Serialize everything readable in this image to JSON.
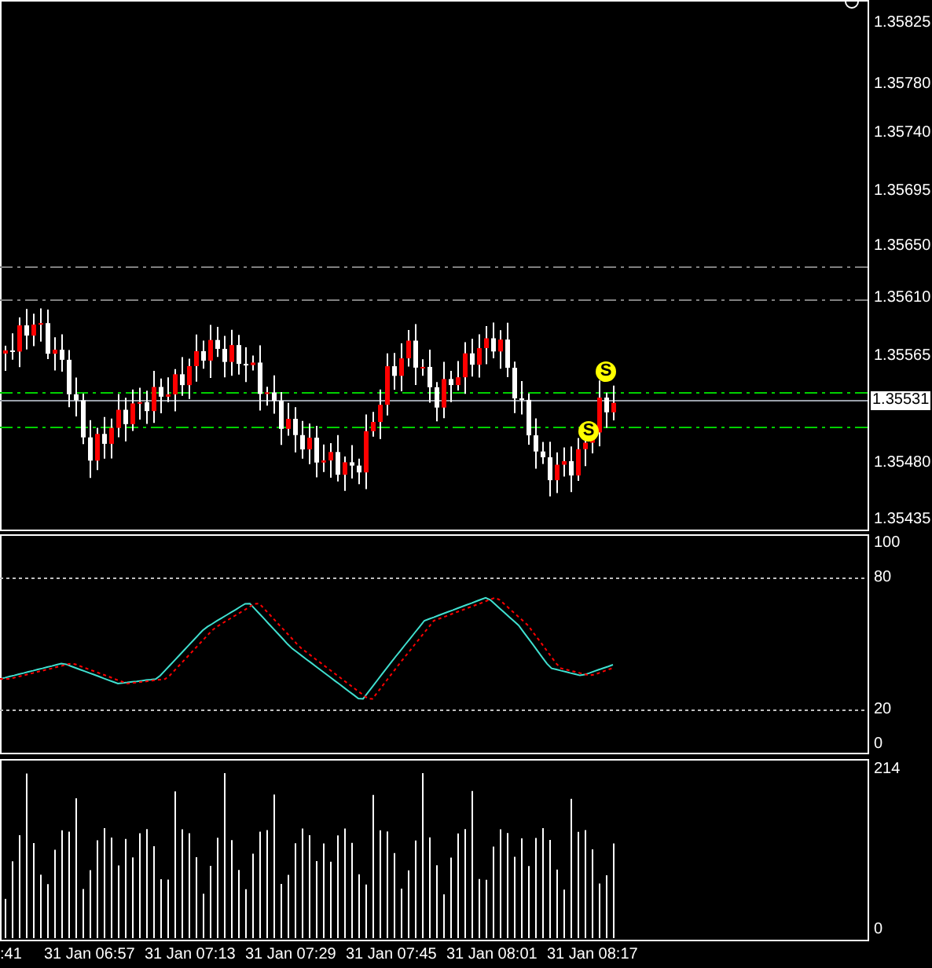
{
  "price_axis": {
    "labels": [
      "1.35825",
      "1.35780",
      "1.35740",
      "1.35695",
      "1.35650",
      "1.35610",
      "1.35565",
      "1.35480",
      "1.35435"
    ],
    "current_price": "1.35531"
  },
  "signals": [
    {
      "label": "S"
    },
    {
      "label": "S"
    }
  ],
  "stochastic_axis": {
    "labels": [
      "100",
      "80",
      "20",
      "0"
    ]
  },
  "volume_axis": {
    "labels": [
      "214",
      "0"
    ]
  },
  "time_axis": {
    "labels": [
      ":41",
      "31 Jan 06:57",
      "31 Jan 07:13",
      "31 Jan 07:29",
      "31 Jan 07:45",
      "31 Jan 08:01",
      "31 Jan 08:17"
    ]
  }
}
